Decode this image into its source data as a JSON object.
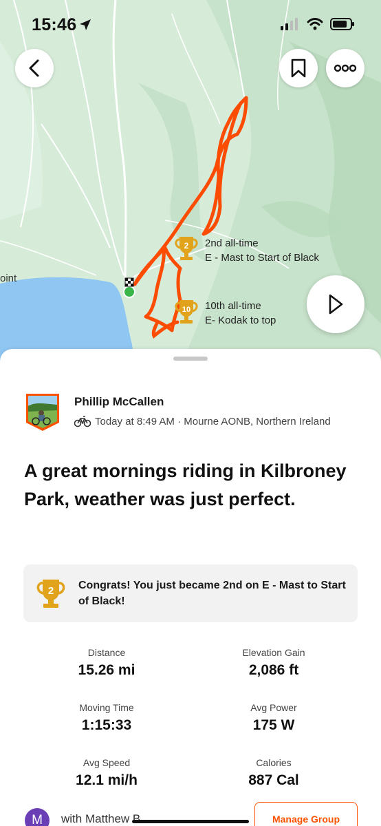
{
  "status_bar": {
    "time": "15:46"
  },
  "map": {
    "place_label": "oint",
    "segments": [
      {
        "rank_badge": "2",
        "rank_text": "2nd all-time",
        "name": "E - Mast to Start of Black"
      },
      {
        "rank_badge": "10",
        "rank_text": "10th all-time",
        "name": "E- Kodak to top"
      }
    ]
  },
  "activity": {
    "athlete_name": "Phillip  McCallen",
    "meta": "Today at 8:49 AM · Mourne AONB, Northern Ireland",
    "title": "A great mornings riding in Kilbroney Park, weather was just perfect."
  },
  "achievement": {
    "badge": "2",
    "text": "Congrats! You just became 2nd on E - Mast to Start of Black!"
  },
  "stats": [
    {
      "label": "Distance",
      "value": "15.26 mi"
    },
    {
      "label": "Elevation Gain",
      "value": "2,086 ft"
    },
    {
      "label": "Moving Time",
      "value": "1:15:33"
    },
    {
      "label": "Avg Power",
      "value": "175 W"
    },
    {
      "label": "Avg Speed",
      "value": "12.1 mi/h"
    },
    {
      "label": "Calories",
      "value": "887 Cal"
    }
  ],
  "group": {
    "avatar_letter": "M",
    "with_text": "with Matthew B",
    "manage_label": "Manage Group"
  },
  "colors": {
    "accent": "#fc5200",
    "route": "#fc4c02",
    "map_land": "#d9eedc",
    "water": "#8fc6f2",
    "trophy_gold": "#e2a31c"
  }
}
